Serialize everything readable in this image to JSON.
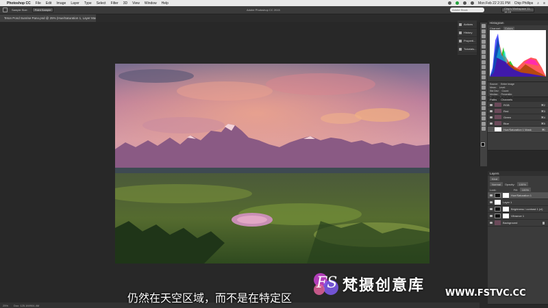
{
  "menubar": {
    "app_name": "Photoshop CC",
    "items": [
      "File",
      "Edit",
      "Image",
      "Layer",
      "Type",
      "Select",
      "Filter",
      "3D",
      "View",
      "Window",
      "Help"
    ],
    "clock": "Mon Feb 22 2:31 PM",
    "user": "Chip Phillips"
  },
  "optionsbar": {
    "sample_size_label": "Sample Size:",
    "sample_size_value": "Point Sample",
    "window_title": "Adobe Photoshop CC 2015",
    "search_placeholder": "Adobe Stock",
    "workspace": "Chip's Workspace 11-16-15"
  },
  "document": {
    "tab_title": "Teton Pond Sunrise Pano.psd @ 25% (Hue/Saturation 1, Layer Mask/16) *",
    "status": "25%",
    "doc_size": "Doc: 125.1M/904.4M"
  },
  "collapsed_panels": [
    "Actions",
    "History",
    "Properti...",
    "Tutorials..."
  ],
  "histogram": {
    "title": "Histogram",
    "channel_label": "Channel:",
    "channel_value": "Colors",
    "source_label": "Source:",
    "source_value": "Entire Image",
    "stats": [
      "Mean:",
      "Std Dev:",
      "Median:",
      "Pixels:",
      "Level:",
      "Count:",
      "Percentile:",
      "Cache Level:"
    ]
  },
  "channels": {
    "tabs": [
      "Paths",
      "Channels"
    ],
    "rows": [
      {
        "name": "RGB",
        "shortcut": "⌘2"
      },
      {
        "name": "Red",
        "shortcut": "⌘3"
      },
      {
        "name": "Green",
        "shortcut": "⌘4"
      },
      {
        "name": "Blue",
        "shortcut": "⌘5"
      },
      {
        "name": "Hue/Saturation 1 Mask",
        "shortcut": "⌘\\"
      }
    ]
  },
  "layers": {
    "title": "Layers",
    "kind": "Kind",
    "blend": "Normal",
    "opacity_label": "Opacity:",
    "opacity": "100%",
    "lock_label": "Lock:",
    "fill_label": "Fill:",
    "fill": "100%",
    "rows": [
      {
        "name": "Hue/Saturation 1"
      },
      {
        "name": "Layer 1"
      },
      {
        "name": "Brightness / contrast 1 (cl)"
      },
      {
        "name": "Vibrance 1"
      },
      {
        "name": "Background"
      }
    ]
  },
  "subtitle": "仍然在天空区域，而不是在特定区",
  "watermark": {
    "logo_text": "FS",
    "brand": "梵摄创意库",
    "url": "WWW.FSTVC.CC"
  }
}
